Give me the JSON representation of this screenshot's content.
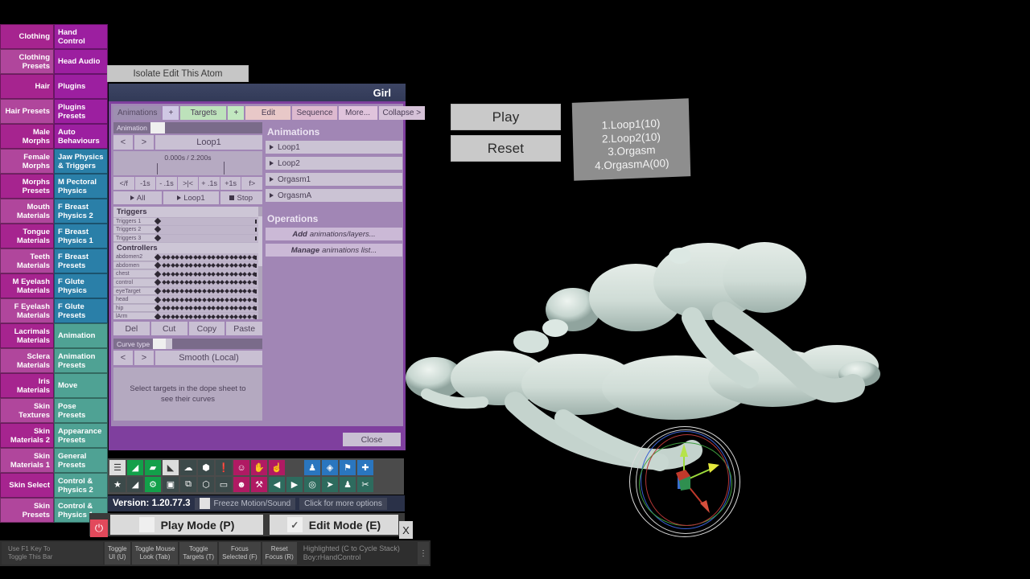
{
  "sidebar": {
    "rows": [
      {
        "left": "Clothing",
        "right": "Hand Control",
        "right_color": "purple"
      },
      {
        "left": "Clothing Presets",
        "right": "Head Audio",
        "right_color": "purple"
      },
      {
        "left": "Hair",
        "right": "Plugins",
        "right_color": "purple"
      },
      {
        "left": "Hair Presets",
        "right": "Plugins Presets",
        "right_color": "purple"
      },
      {
        "left": "Male Morphs",
        "right": "Auto Behaviours",
        "right_color": "purple"
      },
      {
        "left": "Female Morphs",
        "right": "Jaw Physics & Triggers",
        "right_color": "blue"
      },
      {
        "left": "Morphs Presets",
        "right": "M Pectoral Physics",
        "right_color": "blue"
      },
      {
        "left": "Mouth Materials",
        "right": "F Breast Physics 2",
        "right_color": "blue"
      },
      {
        "left": "Tongue Materials",
        "right": "F Breast Physics 1",
        "right_color": "blue"
      },
      {
        "left": "Teeth Materials",
        "right": "F Breast Presets",
        "right_color": "blue"
      },
      {
        "left": "M Eyelash Materials",
        "right": "F Glute Physics",
        "right_color": "blue"
      },
      {
        "left": "F Eyelash Materials",
        "right": "F Glute Presets",
        "right_color": "blue"
      },
      {
        "left": "Lacrimals Materials",
        "right": "Animation",
        "right_color": "teal"
      },
      {
        "left": "Sclera Materials",
        "right": "Animation Presets",
        "right_color": "teal"
      },
      {
        "left": "Iris Materials",
        "right": "Move",
        "right_color": "teal"
      },
      {
        "left": "Skin Textures",
        "right": "Pose Presets",
        "right_color": "teal"
      },
      {
        "left": "Skin Materials 2",
        "right": "Appearance Presets",
        "right_color": "teal"
      },
      {
        "left": "Skin Materials 1",
        "right": "General Presets",
        "right_color": "teal"
      },
      {
        "left": "Skin Select",
        "right": "Control & Physics 2",
        "right_color": "teal"
      },
      {
        "left": "Skin Presets",
        "right": "Control & Physics 1",
        "right_color": "teal"
      }
    ]
  },
  "isolate": {
    "label": "Isolate Edit This Atom"
  },
  "plugin": {
    "title": "Girl",
    "tabs": [
      {
        "label": "Animations",
        "key": "animations"
      },
      {
        "label": "+",
        "key": "add-animation"
      },
      {
        "label": "Targets",
        "key": "targets"
      },
      {
        "label": "+",
        "key": "add-target"
      },
      {
        "label": "Edit",
        "key": "edit"
      },
      {
        "label": "Sequence",
        "key": "sequence"
      },
      {
        "label": "More...",
        "key": "more"
      },
      {
        "label": "Collapse >",
        "key": "collapse"
      }
    ],
    "animation_slider_label": "Animation",
    "prev_label": "<",
    "next_label": ">",
    "current_animation": "Loop1",
    "time_display": "0.000s / 2.200s",
    "scrub_buttons": [
      "</f",
      "-1s",
      "- .1s",
      ">|<",
      "+ .1s",
      "+1s",
      "f>"
    ],
    "play_all_label": "All",
    "play_current_label": "Loop1",
    "stop_label": "Stop",
    "dope_sheet": {
      "triggers_header": "Triggers",
      "trigger_rows": [
        "Triggers 1",
        "Triggers 2",
        "Triggers 3"
      ],
      "controllers_header": "Controllers",
      "controller_rows": [
        "abdomen2",
        "abdomen",
        "chest",
        "control",
        "eyeTarget",
        "head",
        "hip",
        "lArm"
      ]
    },
    "edit_buttons": [
      "Del",
      "Cut",
      "Copy",
      "Paste"
    ],
    "curve_type_label": "Curve type",
    "curve_type_value": "Smooth (Local)",
    "curve_hint": "Select targets in the dope sheet to see their curves",
    "animations_header": "Animations",
    "animations_list": [
      "Loop1",
      "Loop2",
      "Orgasm1",
      "OrgasmA"
    ],
    "operations_header": "Operations",
    "operations": [
      {
        "bold": "Add",
        "rest": "animations/layers..."
      },
      {
        "bold": "Manage",
        "rest": "animations list..."
      }
    ],
    "close_label": "Close"
  },
  "scene": {
    "play_label": "Play",
    "reset_label": "Reset",
    "loop_list": [
      "1.Loop1(10)",
      "2.Loop2(10)",
      "3.Orgasm",
      "4.OrgasmA(00)"
    ]
  },
  "toolbar": {
    "row1": [
      {
        "icon": "menu-icon",
        "glyph": "☰",
        "style": "i-grey"
      },
      {
        "icon": "load-scene-icon",
        "glyph": "◢",
        "style": "i-green"
      },
      {
        "icon": "open-folder-icon",
        "glyph": "▰",
        "style": "i-green"
      },
      {
        "icon": "save-scene-icon",
        "glyph": "◣",
        "style": "i-grey"
      },
      {
        "icon": "cloud-icon",
        "glyph": "☁",
        "style": "i-dark"
      },
      {
        "icon": "package-icon",
        "glyph": "⬢",
        "style": "i-dark"
      },
      {
        "icon": "alert-icon",
        "glyph": "❗",
        "style": "i-dark"
      },
      {
        "icon": "add-person-icon",
        "glyph": "☺",
        "style": "i-magenta"
      },
      {
        "icon": "hand-icon",
        "glyph": "✋",
        "style": "i-magenta"
      },
      {
        "icon": "pointer-hand-icon",
        "glyph": "☝",
        "style": "i-magenta"
      },
      {
        "icon": "spacer",
        "glyph": "",
        "style": "gap"
      },
      {
        "icon": "person-icon",
        "glyph": "♟",
        "style": "i-blue"
      },
      {
        "icon": "unity-icon",
        "glyph": "◈",
        "style": "i-blue"
      },
      {
        "icon": "flag-icon",
        "glyph": "⚑",
        "style": "i-blue"
      },
      {
        "icon": "plus-icon",
        "glyph": "✚",
        "style": "i-blue"
      }
    ],
    "row2": [
      {
        "icon": "star-icon",
        "glyph": "★",
        "style": "i-dark"
      },
      {
        "icon": "load-preset-icon",
        "glyph": "◢",
        "style": "i-dark"
      },
      {
        "icon": "folder-settings-icon",
        "glyph": "⚙",
        "style": "i-green"
      },
      {
        "icon": "camera-icon",
        "glyph": "▣",
        "style": "i-dark"
      },
      {
        "icon": "node-graph-icon",
        "glyph": "⧉",
        "style": "i-dark"
      },
      {
        "icon": "package-open-icon",
        "glyph": "⬡",
        "style": "i-dark"
      },
      {
        "icon": "document-icon",
        "glyph": "▭",
        "style": "i-dark"
      },
      {
        "icon": "remove-person-icon",
        "glyph": "☻",
        "style": "i-magenta"
      },
      {
        "icon": "wrench-icon",
        "glyph": "⚒",
        "style": "i-magenta"
      },
      {
        "icon": "skip-back-icon",
        "glyph": "◀",
        "style": "i-teal"
      },
      {
        "icon": "play-icon",
        "glyph": "▶",
        "style": "i-teal"
      },
      {
        "icon": "target-icon",
        "glyph": "◎",
        "style": "i-teal"
      },
      {
        "icon": "cursor-icon",
        "glyph": "➤",
        "style": "i-teal"
      },
      {
        "icon": "person-select-icon",
        "glyph": "♟",
        "style": "i-teal"
      },
      {
        "icon": "tools-icon",
        "glyph": "✂",
        "style": "i-teal"
      }
    ]
  },
  "statusbar": {
    "version": "Version: 1.20.77.3",
    "freeze_label": "Freeze Motion/Sound",
    "more_options_label": "Click for more options",
    "play_mode_label": "Play Mode (P)",
    "edit_mode_label": "Edit Mode (E)",
    "edit_mode_checked": "✓",
    "close_x": "X",
    "power_glyph": "⏻"
  },
  "hintbar": {
    "note_line1": "Use F1 Key To",
    "note_line2": "Toggle This Bar",
    "buttons": [
      {
        "line1": "Toggle",
        "line2": "UI (U)"
      },
      {
        "line1": "Toggle Mouse",
        "line2": "Look (Tab)"
      },
      {
        "line1": "Toggle",
        "line2": "Targets (T)"
      },
      {
        "line1": "Focus",
        "line2": "Selected (F)"
      },
      {
        "line1": "Reset",
        "line2": "Focus (R)"
      }
    ],
    "status_line1": "Highlighted (C to Cycle Stack)",
    "status_line2": "Boy:rHandControl",
    "menu_glyph": "⋮"
  },
  "colors": {
    "sidebar_magenta": "#a6248f",
    "sidebar_purple": "#9c1fa0",
    "sidebar_blue": "#2a7fa8",
    "sidebar_teal": "#4fa294",
    "window_purple": "#7f3f9e",
    "panel_lavender": "#a186b5",
    "titlebar_navy": "#3d4564",
    "version_navy": "#2a3148",
    "power_red": "#e2495b"
  }
}
